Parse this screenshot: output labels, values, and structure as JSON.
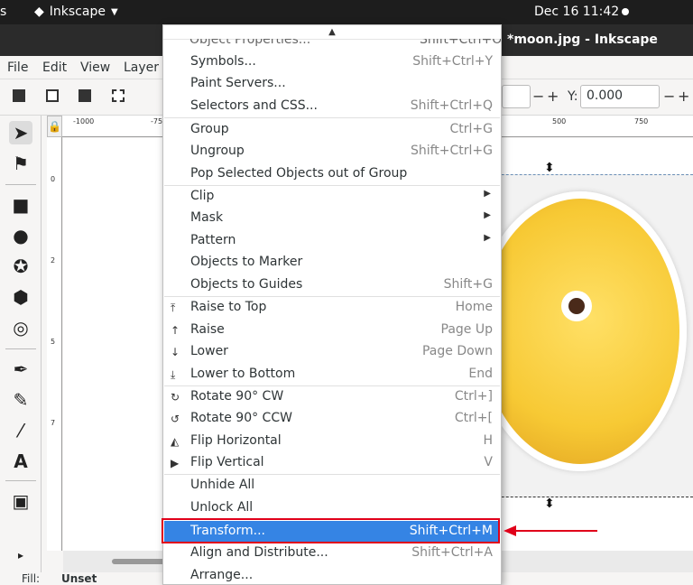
{
  "topbar": {
    "activities_fragment": "s",
    "app_name": "Inkscape",
    "clock": "Dec 16  11:42"
  },
  "window": {
    "title": "*moon.jpg - Inkscape"
  },
  "menubar": {
    "items": [
      "File",
      "Edit",
      "View",
      "Layer"
    ]
  },
  "controls": {
    "x_value": "",
    "y_label": "Y:",
    "y_value": "0.000",
    "minus": "−",
    "plus": "+"
  },
  "ruler": {
    "h_ticks": [
      "-1000",
      "-75",
      "500",
      "750"
    ],
    "v_ticks": [
      "0",
      "2",
      "5",
      "7"
    ]
  },
  "status": {
    "fill_label": "Fill:",
    "fill_value": "Unset"
  },
  "menu": {
    "scroll_up": "▲",
    "clipped_item": "Object Properties...",
    "clipped_shortcut": "Shift+Ctrl+O",
    "items": [
      {
        "label": "Symbols...",
        "shortcut": "Shift+Ctrl+Y"
      },
      {
        "label": "Paint Servers...",
        "shortcut": ""
      },
      {
        "label": "Selectors and CSS...",
        "shortcut": "Shift+Ctrl+Q"
      },
      {
        "label": "Group",
        "shortcut": "Ctrl+G"
      },
      {
        "label": "Ungroup",
        "shortcut": "Shift+Ctrl+G"
      },
      {
        "label": "Pop Selected Objects out of Group",
        "shortcut": ""
      },
      {
        "label": "Clip",
        "shortcut": ""
      },
      {
        "label": "Mask",
        "shortcut": ""
      },
      {
        "label": "Pattern",
        "shortcut": ""
      },
      {
        "label": "Objects to Marker",
        "shortcut": ""
      },
      {
        "label": "Objects to Guides",
        "shortcut": "Shift+G"
      },
      {
        "label": "Raise to Top",
        "shortcut": "Home"
      },
      {
        "label": "Raise",
        "shortcut": "Page Up"
      },
      {
        "label": "Lower",
        "shortcut": "Page Down"
      },
      {
        "label": "Lower to Bottom",
        "shortcut": "End"
      },
      {
        "label": "Rotate 90° CW",
        "shortcut": "Ctrl+]"
      },
      {
        "label": "Rotate 90° CCW",
        "shortcut": "Ctrl+["
      },
      {
        "label": "Flip Horizontal",
        "shortcut": "H"
      },
      {
        "label": "Flip Vertical",
        "shortcut": "V"
      },
      {
        "label": "Unhide All",
        "shortcut": ""
      },
      {
        "label": "Unlock All",
        "shortcut": ""
      },
      {
        "label": "Transform...",
        "shortcut": "Shift+Ctrl+M"
      },
      {
        "label": "Align and Distribute...",
        "shortcut": "Shift+Ctrl+A"
      },
      {
        "label": "Arrange...",
        "shortcut": ""
      }
    ],
    "highlight_color": "#3584e4"
  },
  "annotation": {
    "color": "#e0001a"
  }
}
